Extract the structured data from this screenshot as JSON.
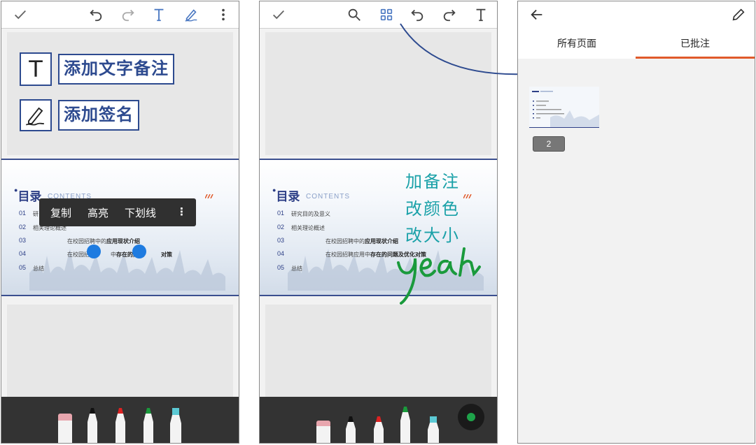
{
  "panel1": {
    "annotation_text_label": "添加文字备注",
    "annotation_sign_label": "添加签名",
    "text_icon_glyph": "T",
    "popup": {
      "copy": "复制",
      "highlight": "高亮",
      "underline": "下划线",
      "more": "⋮"
    }
  },
  "slide": {
    "title": "目录",
    "subtitle": "CONTENTS",
    "items": [
      {
        "num": "01",
        "text": "研究目的及意义"
      },
      {
        "num": "02",
        "text": "相关理论概述"
      },
      {
        "num": "03",
        "text_plain": "在校园招聘中的",
        "text_bold": "应用现状介绍"
      },
      {
        "num": "04",
        "text_plain": "在校园招聘应用中",
        "text_bold": "存在的问题及优化对策"
      },
      {
        "num": "05",
        "text": "总结"
      }
    ],
    "p1_item1_visible": "研",
    "p1_item2_visible": "相关理论概述",
    "p1_item4_plain": "在校园招聘",
    "p1_item4_mid": "中",
    "p1_item4_bold": "存在的问题",
    "p1_item4_tail": "对策"
  },
  "panel2": {
    "handwriting": [
      "加备注",
      "改颜色",
      "改大小"
    ],
    "scribble": "yeah"
  },
  "panel3": {
    "tab_all": "所有页面",
    "tab_annotated": "已批注",
    "page_badge": "2"
  },
  "colors": {
    "annotation_blue": "#2d4a8f",
    "handwriting_teal": "#1aa1a8",
    "scribble_green": "#1a9a3c",
    "tab_accent": "#e05a2b",
    "selection_blue": "#1e7be0"
  },
  "icons": {
    "p1_toolbar": [
      "check-icon",
      "undo-icon",
      "redo-icon",
      "text-icon",
      "pen-icon",
      "more-icon"
    ],
    "p2_toolbar": [
      "check-icon",
      "search-icon",
      "grid-icon",
      "undo-icon",
      "redo-icon",
      "text-icon"
    ],
    "p3_toolbar": [
      "back-arrow-icon",
      "edit-pencil-icon"
    ]
  }
}
